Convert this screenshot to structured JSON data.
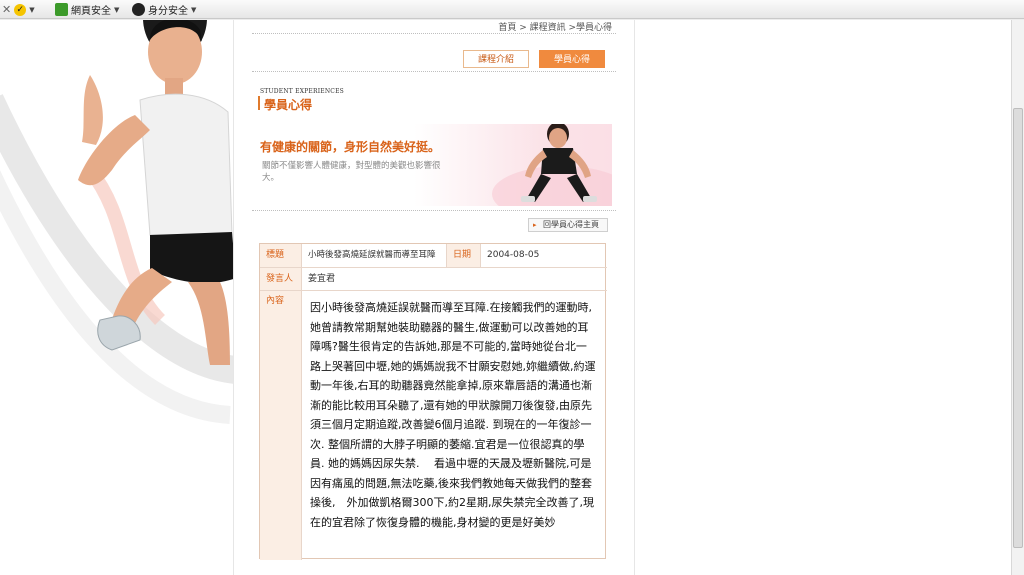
{
  "toolbar": {
    "items": [
      {
        "label": "網頁安全",
        "icon": "green-shield-icon"
      },
      {
        "label": "身分安全",
        "icon": "identity-icon"
      }
    ]
  },
  "breadcrumb": "首頁 > 課程資訊 >學員心得",
  "tabs": {
    "course_intro": "課程介紹",
    "student_feedback": "學員心得"
  },
  "section": {
    "title_en": "STUDENT EXPERIENCES",
    "title": "學員心得"
  },
  "banner": {
    "headline": "有健康的關節，身形自然美好挺。",
    "sub": "關節不僅影響人體健康，對型體的美觀也影響很大。"
  },
  "back_button": "回學員心得主頁",
  "post": {
    "title_label": "標題",
    "title_value": "小時後發高燒延誤就醫而導至耳障",
    "date_label": "日期",
    "date_value": "2004-08-05",
    "author_label": "發言人",
    "author_value": "姜宜君",
    "content_label": "內容",
    "content": "因小時後發高燒延誤就醫而導至耳障.在接觸我們的運動時,她曾請教常期幫她裝助聽器的醫生,做運動可以改善她的耳障嗎?醫生很肯定的告訴她,那是不可能的,當時她從台北一路上哭著回中壢,她的媽媽說我不甘願安慰她,妳繼續做,約運動一年後,右耳的助聽器竟然能拿掉,原來靠唇語的溝通也漸漸的能比較用耳朵聽了,還有她的甲狀腺開刀後復發,由原先須三個月定期追蹤,改善變6個月追蹤. 到現在的一年復診一次. 整個所謂的大脖子明顯的萎縮.宜君是一位很認真的學員. 她的媽媽因尿失禁.　 看過中壢的天晟及壢新醫院,可是因有痛風的問題,無法吃藥,後來我們教她每天做我們的整套操後,　外加做凱格爾300下,約2星期,尿失禁完全改善了,現在的宜君除了恢復身體的機能,身材變的更是好美妙"
  },
  "colors": {
    "accent": "#d9631a",
    "tab_active": "#f08a3e",
    "label_bg": "#fbeee4"
  }
}
